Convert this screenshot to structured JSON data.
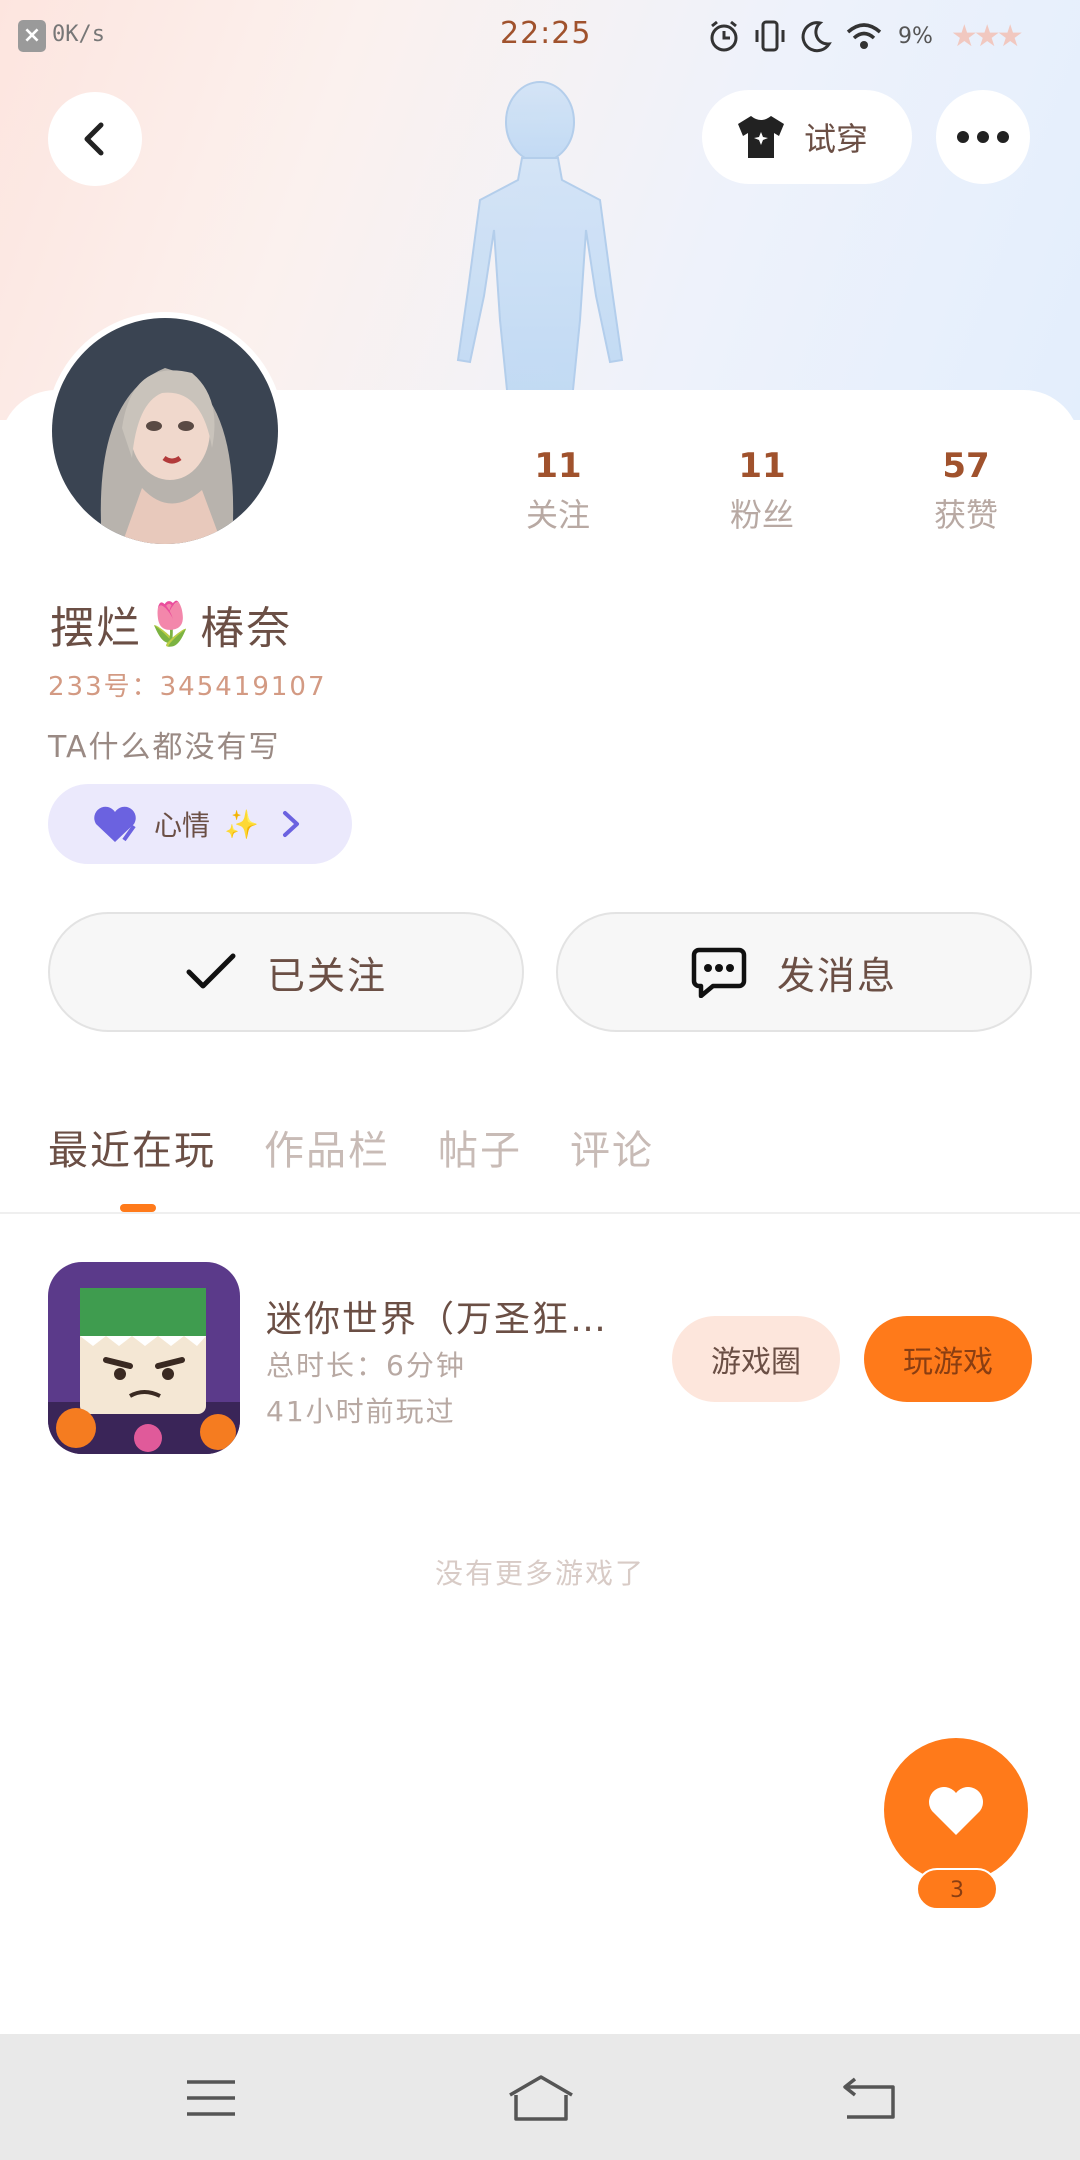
{
  "status_bar": {
    "close_glyph": "×",
    "net_speed": "0K/s",
    "time": "22:25",
    "battery": "9%",
    "decor": "★★★"
  },
  "header": {
    "try_on_label": "试穿"
  },
  "stats": [
    {
      "value": "11",
      "label": "关注"
    },
    {
      "value": "11",
      "label": "粉丝"
    },
    {
      "value": "57",
      "label": "获赞"
    }
  ],
  "profile": {
    "name_part1": "摆烂",
    "name_emoji": "🌷",
    "name_part2": "椿奈",
    "uid": "233号：345419107",
    "bio": "TA什么都没有写",
    "mood_label": "心情",
    "mood_emoji": "✨"
  },
  "actions": {
    "follow_label": "已关注",
    "message_label": "发消息"
  },
  "tabs": [
    "最近在玩",
    "作品栏",
    "帖子",
    "评论"
  ],
  "game": {
    "title": "迷你世界（万圣狂…",
    "duration": "总时长：6分钟",
    "last_played": "41小时前玩过",
    "circle_label": "游戏圈",
    "play_label": "玩游戏"
  },
  "list_end_text": "没有更多游戏了",
  "like": {
    "count": "3"
  },
  "colors": {
    "accent": "#ff7a1a",
    "text": "#6b4f45",
    "muted": "#b8a9a3",
    "mood_bg": "#ebe9fc"
  },
  "icons": [
    "back-icon",
    "shirt-icon",
    "more-icon",
    "check-icon",
    "chat-icon",
    "heart-icon",
    "chevron-right-icon",
    "menu-icon",
    "home-icon",
    "return-icon"
  ]
}
